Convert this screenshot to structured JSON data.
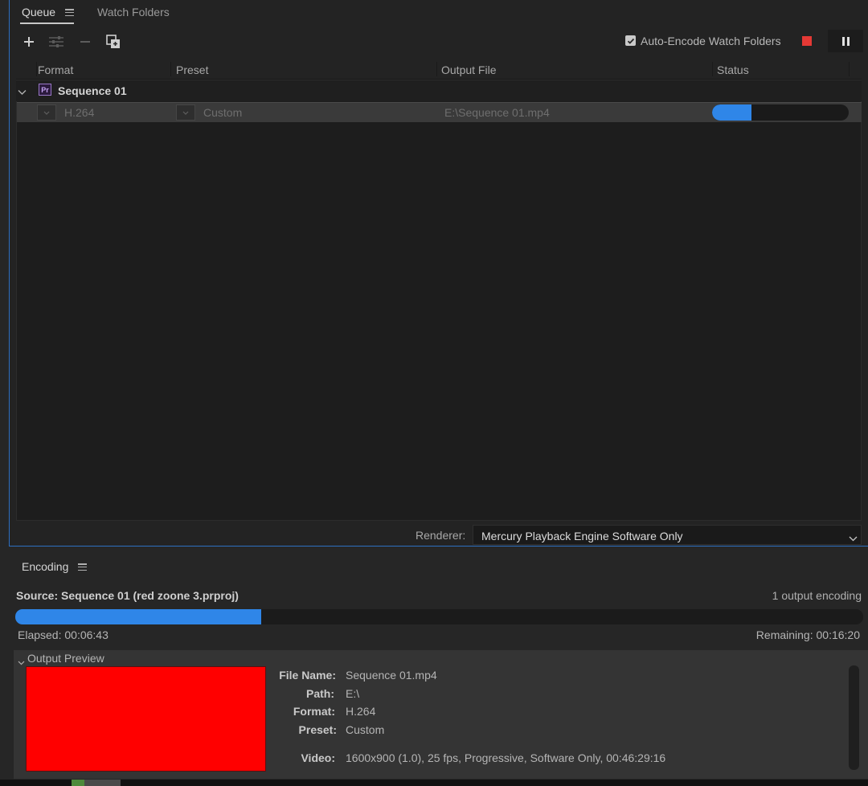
{
  "queue": {
    "tabs": [
      {
        "label": "Queue",
        "active": true
      },
      {
        "label": "Watch Folders",
        "active": false
      }
    ],
    "toolbar": {
      "add_icon": "plus-icon",
      "settings_icon": "sliders-icon",
      "remove_icon": "minus-icon",
      "duplicate_icon": "duplicate-icon"
    },
    "auto_encode_label": "Auto-Encode Watch Folders",
    "auto_encode_checked": true,
    "columns": [
      "Format",
      "Preset",
      "Output File",
      "Status"
    ],
    "group": {
      "name": "Sequence 01",
      "app_badge": "Pr"
    },
    "item": {
      "format": "H.264",
      "preset": "Custom",
      "output_file": "E:\\Sequence 01.mp4",
      "progress": 0.29
    },
    "renderer_label": "Renderer:",
    "renderer_value": "Mercury Playback Engine Software Only"
  },
  "encoding": {
    "title": "Encoding",
    "source": "Source: Sequence 01 (red zoone 3.prproj)",
    "outputs_count": "1 output encoding",
    "progress": 0.29,
    "elapsed": "Elapsed: 00:06:43",
    "remaining": "Remaining: 00:16:20",
    "output_preview_label": "Output Preview",
    "preview_color": "#ff0000",
    "details": [
      {
        "label": "File Name:",
        "value": "Sequence 01.mp4"
      },
      {
        "label": "Path:",
        "value": "E:\\"
      },
      {
        "label": "Format:",
        "value": "H.264"
      },
      {
        "label": "Preset:",
        "value": "Custom"
      },
      {
        "label": "Video:",
        "value": "1600x900 (1.0), 25 fps, Progressive, Software Only, 00:46:29:16"
      }
    ]
  },
  "colors": {
    "accent_blue": "#2f86e8",
    "stop_red": "#e53935",
    "panel_border": "#2d6fc1"
  }
}
